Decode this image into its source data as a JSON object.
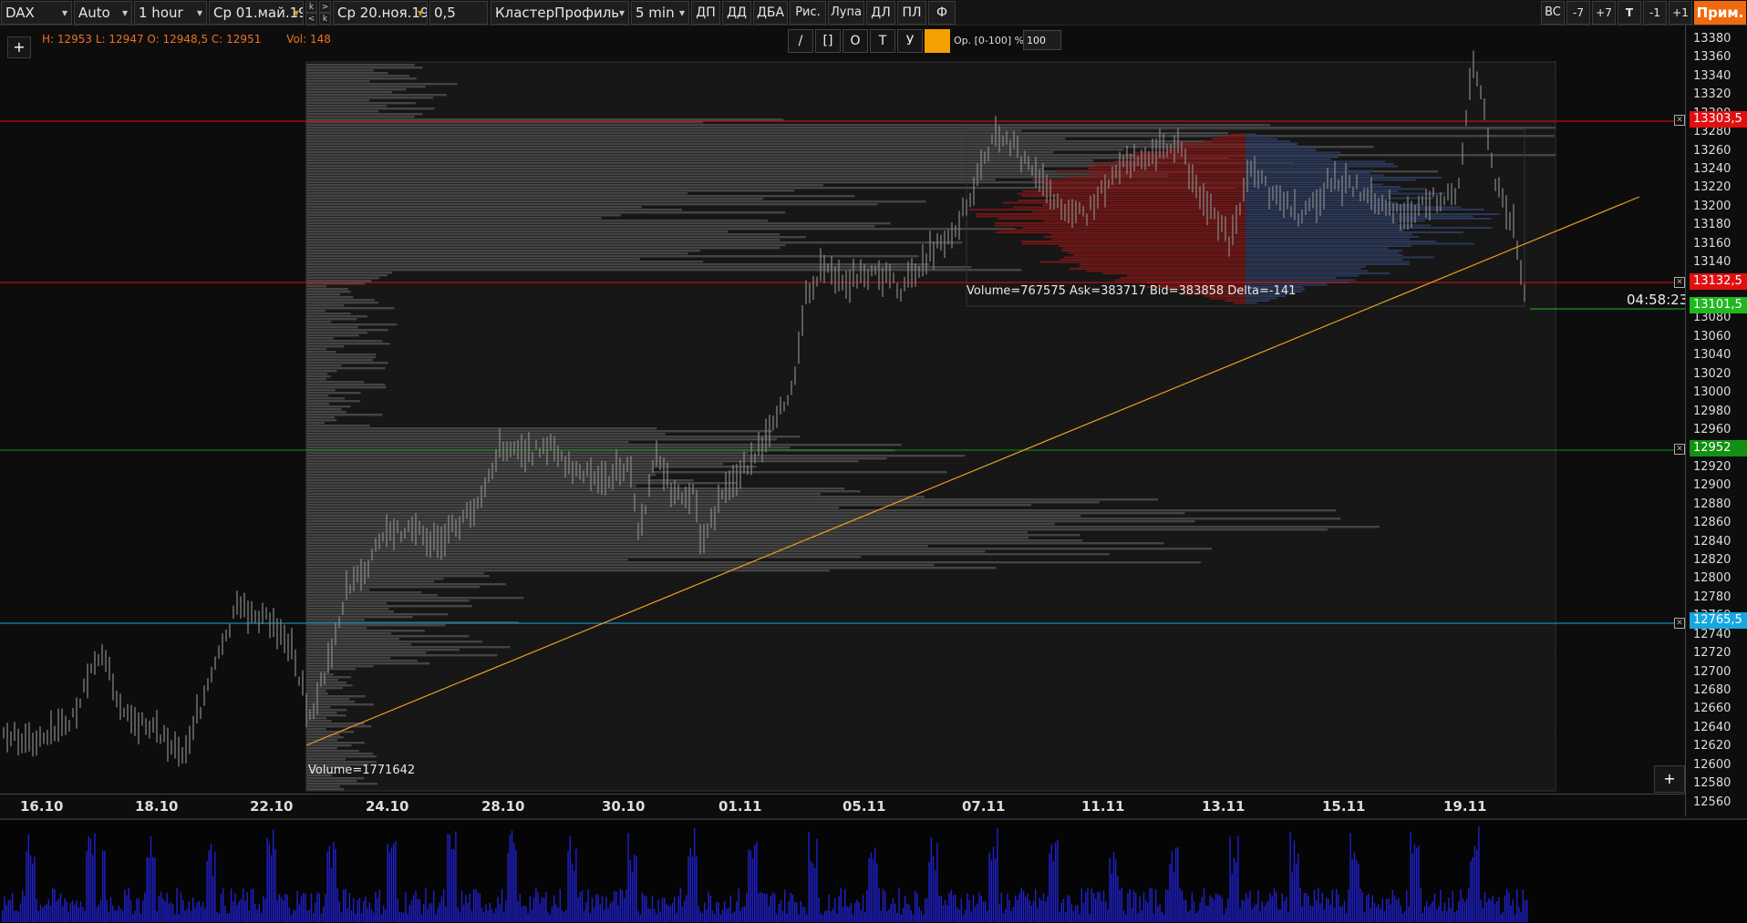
{
  "toolbar": {
    "symbol": "DAX",
    "mode": "Auto",
    "timeframe": "1 hour",
    "date_from": "Ср 01.май.19",
    "date_to": "Ср 20.ноя.19",
    "step": "0,5",
    "profile_type": "КластерПрофиль",
    "profile_period": "5 min",
    "buttons_left": [
      "ДП",
      "ДД",
      "ДБА",
      "Рис.",
      "Лупа",
      "ДЛ",
      "ПЛ",
      "Ф"
    ],
    "buttons_right": [
      "BC",
      "-7",
      "+7",
      "T",
      "-1",
      "+1"
    ],
    "apply_label": "Прим.",
    "arrow_up": "k",
    "arrow_up2": ">",
    "arrow_down": "<",
    "arrow_down2": "k"
  },
  "ohlc": {
    "hlc": "H: 12953 L: 12947 O: 12948,5 C: 12951",
    "vol": "Vol: 148"
  },
  "draw_tools": {
    "tools": [
      "/",
      "[]",
      "O",
      "T",
      "У"
    ],
    "opacity_label": "Ор. [0-100] %:",
    "opacity_value": "100"
  },
  "price_axis": {
    "labels": [
      "13380",
      "13360",
      "13340",
      "13320",
      "13300",
      "13280",
      "13260",
      "13240",
      "13220",
      "13200",
      "13180",
      "13160",
      "13140",
      "13120",
      "13080",
      "13060",
      "13040",
      "13020",
      "13000",
      "12980",
      "12960",
      "12940",
      "12920",
      "12900",
      "12880",
      "12860",
      "12840",
      "12820",
      "12800",
      "12780",
      "12760",
      "12740",
      "12720",
      "12700",
      "12680",
      "12660",
      "12640",
      "12620",
      "12600",
      "12580",
      "12560"
    ],
    "badges": [
      {
        "text": "13303,5",
        "color": "#e01010"
      },
      {
        "text": "13132,5",
        "color": "#e01010"
      },
      {
        "text": "13101,5",
        "color": "#1fb81f"
      },
      {
        "text": "12952",
        "color": "#129012"
      },
      {
        "text": "12765,5",
        "color": "#16a6e0"
      }
    ]
  },
  "time_axis": {
    "labels": [
      "16.10",
      "18.10",
      "22.10",
      "24.10",
      "28.10",
      "30.10",
      "01.11",
      "05.11",
      "07.11",
      "11.11",
      "13.11",
      "15.11",
      "19.11"
    ]
  },
  "annotations": {
    "profile_big": "Volume=1771642",
    "profile_small": "Volume=767575  Ask=383717  Bid=383858  Delta=-141",
    "timer": "04:58:23"
  },
  "colors": {
    "resistance": "#e01010",
    "support_green": "#129012",
    "support_blue": "#16a6e0",
    "trendline": "#e8a020",
    "volume_bars": "#2020d0",
    "accent": "#f06a10"
  }
}
